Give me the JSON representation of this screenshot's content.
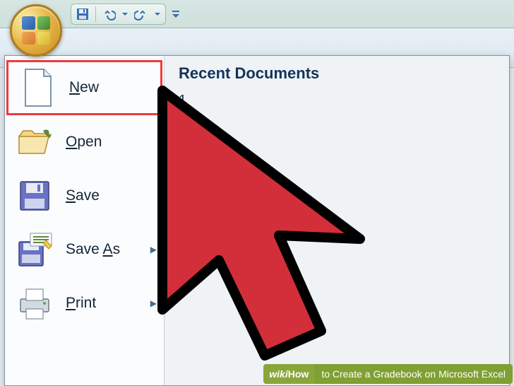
{
  "qat": {
    "save_tooltip": "Save",
    "undo_tooltip": "Undo",
    "redo_tooltip": "Redo"
  },
  "office_button": {
    "name": "Office Button"
  },
  "menu": {
    "items": [
      {
        "label": "New",
        "accel_index": 0,
        "has_submenu": false
      },
      {
        "label": "Open",
        "accel_index": 0,
        "has_submenu": false
      },
      {
        "label": "Save",
        "accel_index": 0,
        "has_submenu": false
      },
      {
        "label": "Save As",
        "accel_index": 5,
        "has_submenu": true
      },
      {
        "label": "Print",
        "accel_index": 0,
        "has_submenu": true
      }
    ]
  },
  "recent": {
    "title": "Recent Documents",
    "items": [
      {
        "label": "1"
      }
    ]
  },
  "caption": {
    "brand": "wikiHow",
    "text": " to Create a Gradebook on Microsoft Excel"
  }
}
